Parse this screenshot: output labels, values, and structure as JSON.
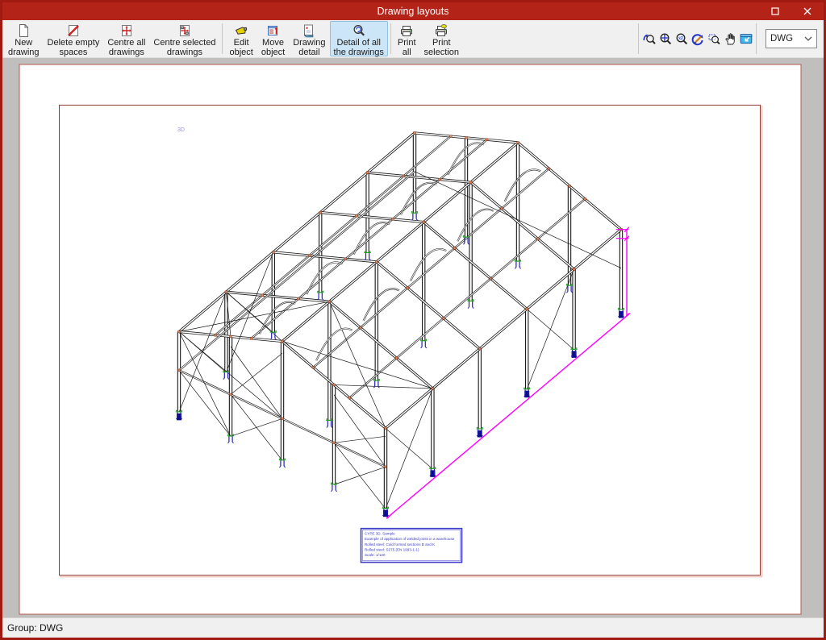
{
  "window": {
    "title": "Drawing layouts",
    "controls": [
      {
        "name": "maximize"
      },
      {
        "name": "close"
      }
    ]
  },
  "toolbar": {
    "selected_label": "Detail of all\nthe drawings",
    "groups": [
      {
        "buttons": [
          {
            "label": "New\ndrawing",
            "icon": "new-drawing"
          },
          {
            "label": "Delete empty\nspaces",
            "icon": "delete-empty-spaces"
          },
          {
            "label": "Centre all\ndrawings",
            "icon": "centre-all-drawings"
          },
          {
            "label": "Centre selected\ndrawings",
            "icon": "centre-selected-drawings"
          }
        ]
      },
      {
        "buttons": [
          {
            "label": "Edit\nobject",
            "icon": "edit-object"
          },
          {
            "label": "Move\nobject",
            "icon": "move-object"
          },
          {
            "label": "Drawing\ndetail",
            "icon": "drawing-detail"
          },
          {
            "label": "Detail of all\nthe drawings",
            "icon": "detail-all-drawings"
          }
        ]
      },
      {
        "buttons": [
          {
            "label": "Print\nall",
            "icon": "print-all"
          },
          {
            "label": "Print\nselection",
            "icon": "print-selection"
          }
        ]
      }
    ],
    "zoom_tools": [
      {
        "name": "zoom-previous"
      },
      {
        "name": "zoom-extents"
      },
      {
        "name": "zoom-x2"
      },
      {
        "name": "redraw"
      },
      {
        "name": "zoom-window"
      },
      {
        "name": "pan"
      },
      {
        "name": "previous-window"
      }
    ],
    "format_select": {
      "value": "DWG"
    }
  },
  "canvas": {
    "view_label": "3D",
    "title_block": {
      "lines": [
        "CYPE 3D. Sample",
        "Example of application of welded joints in a warehouse",
        "Rolled steel: Cold formed sections B and K",
        "Rolled steel: S275 (EN 1993-1-1)",
        "Scale: 1/120"
      ]
    },
    "colors": {
      "member": "#181818",
      "dimension": "#ff00ff",
      "node": "#d8895e",
      "node_edge": "#83351a",
      "anchor_blue": "#1e1eb4",
      "anchor_solid": "#0d0d8c",
      "anchor_green": "#1ca01c",
      "view_label_blue": "#9292e0",
      "title_block_blue": "#3c3cc8",
      "page_border": "#b25b52",
      "frame_border": "#8e3b32",
      "frame_shadow": "#efc4bd"
    }
  },
  "status_bar": {
    "text": "Group: DWG"
  }
}
